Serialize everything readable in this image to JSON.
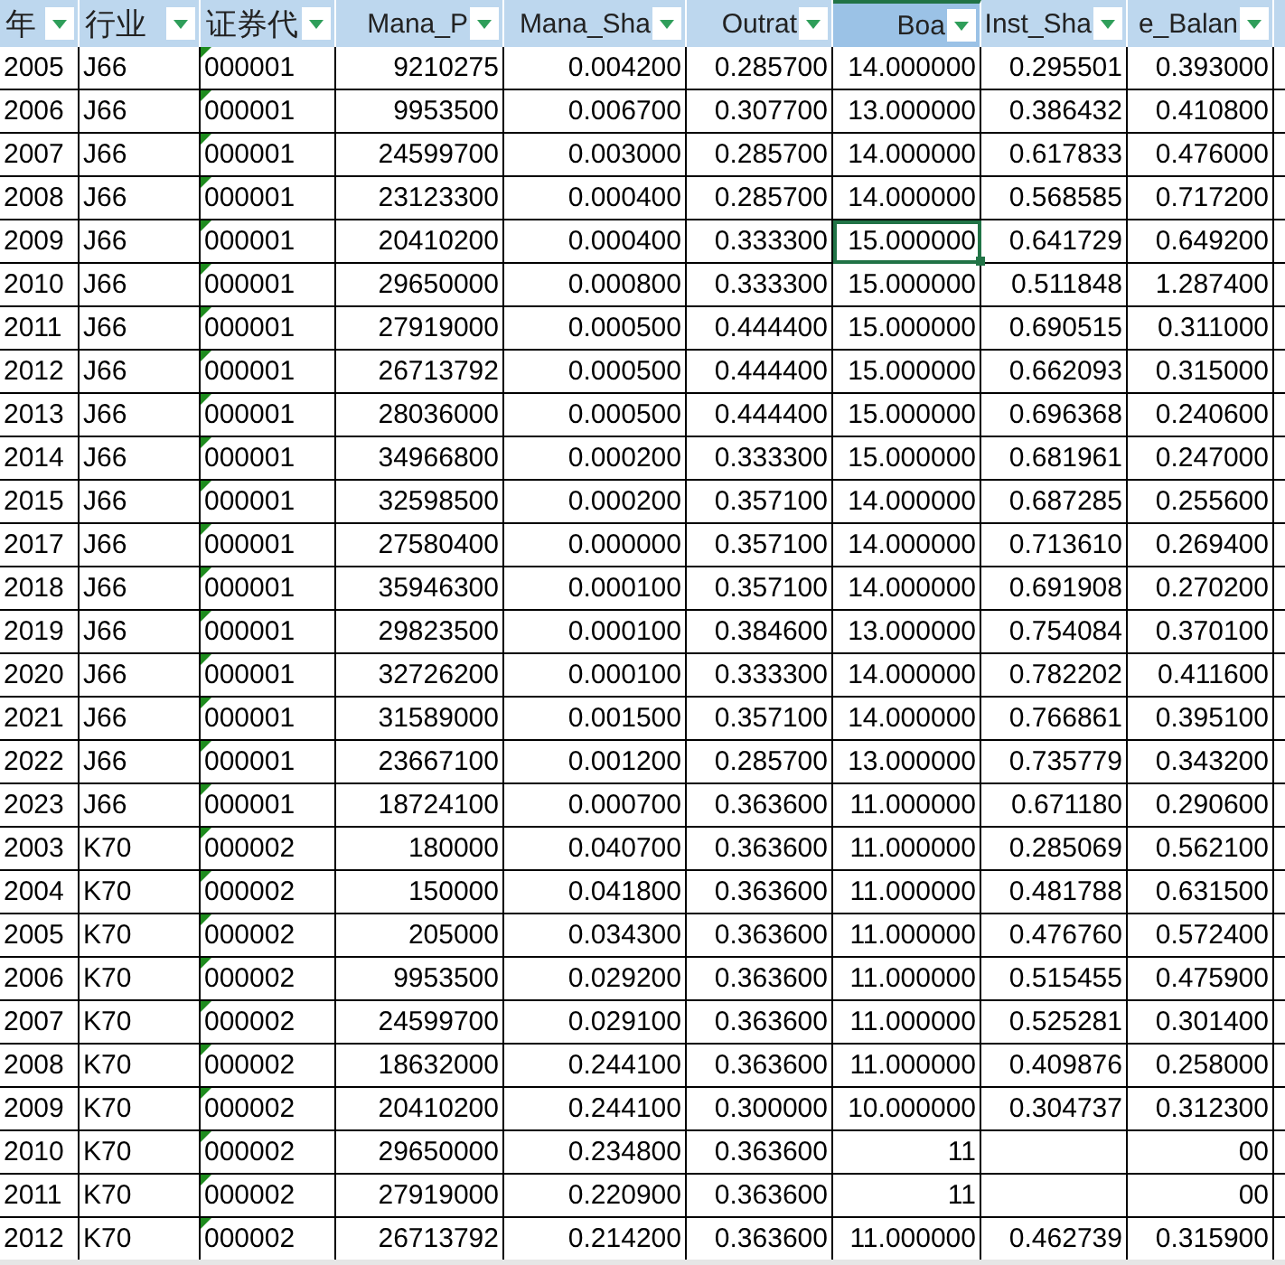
{
  "columns": [
    {
      "label": "年",
      "kind": "number",
      "selected": false,
      "text_warning": false
    },
    {
      "label": "行业",
      "kind": "text",
      "selected": false,
      "text_warning": false
    },
    {
      "label": "证券代",
      "kind": "text",
      "selected": false,
      "text_warning": true
    },
    {
      "label": "Mana_P",
      "kind": "number",
      "selected": false,
      "text_warning": false
    },
    {
      "label": "Mana_Sha",
      "kind": "number",
      "selected": false,
      "text_warning": false
    },
    {
      "label": "Outrat",
      "kind": "number",
      "selected": false,
      "text_warning": false
    },
    {
      "label": "Boa",
      "kind": "number",
      "selected": true,
      "text_warning": false
    },
    {
      "label": "Inst_Sha",
      "kind": "number",
      "selected": false,
      "text_warning": false
    },
    {
      "label": "e_Balan",
      "kind": "number",
      "selected": false,
      "text_warning": false
    }
  ],
  "rows": [
    {
      "cells": [
        "2005",
        "J66",
        "000001",
        "9210275",
        "0.004200",
        "0.285700",
        "14.000000",
        "0.295501",
        "0.393000"
      ]
    },
    {
      "cells": [
        "2006",
        "J66",
        "000001",
        "9953500",
        "0.006700",
        "0.307700",
        "13.000000",
        "0.386432",
        "0.410800"
      ]
    },
    {
      "cells": [
        "2007",
        "J66",
        "000001",
        "24599700",
        "0.003000",
        "0.285700",
        "14.000000",
        "0.617833",
        "0.476000"
      ]
    },
    {
      "cells": [
        "2008",
        "J66",
        "000001",
        "23123300",
        "0.000400",
        "0.285700",
        "14.000000",
        "0.568585",
        "0.717200"
      ]
    },
    {
      "cells": [
        "2009",
        "J66",
        "000001",
        "20410200",
        "0.000400",
        "0.333300",
        {
          "text": "15.000000",
          "selected": true
        },
        "0.641729",
        "0.649200"
      ]
    },
    {
      "cells": [
        "2010",
        "J66",
        "000001",
        "29650000",
        "0.000800",
        "0.333300",
        "15.000000",
        "0.511848",
        "1.287400"
      ]
    },
    {
      "cells": [
        "2011",
        "J66",
        "000001",
        "27919000",
        "0.000500",
        "0.444400",
        "15.000000",
        "0.690515",
        "0.311000"
      ]
    },
    {
      "cells": [
        "2012",
        "J66",
        "000001",
        "26713792",
        "0.000500",
        "0.444400",
        "15.000000",
        "0.662093",
        "0.315000"
      ]
    },
    {
      "cells": [
        "2013",
        "J66",
        "000001",
        "28036000",
        "0.000500",
        "0.444400",
        "15.000000",
        "0.696368",
        "0.240600"
      ]
    },
    {
      "cells": [
        "2014",
        "J66",
        "000001",
        "34966800",
        "0.000200",
        "0.333300",
        "15.000000",
        "0.681961",
        "0.247000"
      ]
    },
    {
      "cells": [
        "2015",
        "J66",
        "000001",
        "32598500",
        "0.000200",
        "0.357100",
        "14.000000",
        "0.687285",
        "0.255600"
      ]
    },
    {
      "cells": [
        "2017",
        "J66",
        "000001",
        "27580400",
        "0.000000",
        "0.357100",
        "14.000000",
        "0.713610",
        "0.269400"
      ]
    },
    {
      "cells": [
        "2018",
        "J66",
        "000001",
        "35946300",
        "0.000100",
        "0.357100",
        "14.000000",
        "0.691908",
        "0.270200"
      ]
    },
    {
      "cells": [
        "2019",
        "J66",
        "000001",
        "29823500",
        "0.000100",
        "0.384600",
        "13.000000",
        "0.754084",
        "0.370100"
      ]
    },
    {
      "cells": [
        "2020",
        "J66",
        "000001",
        "32726200",
        "0.000100",
        "0.333300",
        "14.000000",
        "0.782202",
        "0.411600"
      ]
    },
    {
      "cells": [
        "2021",
        "J66",
        "000001",
        "31589000",
        "0.001500",
        "0.357100",
        "14.000000",
        "0.766861",
        "0.395100"
      ]
    },
    {
      "cells": [
        "2022",
        "J66",
        "000001",
        "23667100",
        "0.001200",
        "0.285700",
        "13.000000",
        "0.735779",
        "0.343200"
      ]
    },
    {
      "cells": [
        "2023",
        "J66",
        "000001",
        "18724100",
        "0.000700",
        "0.363600",
        "11.000000",
        "0.671180",
        "0.290600"
      ]
    },
    {
      "cells": [
        "2003",
        "K70",
        "000002",
        "180000",
        "0.040700",
        "0.363600",
        "11.000000",
        "0.285069",
        "0.562100"
      ]
    },
    {
      "cells": [
        "2004",
        "K70",
        "000002",
        "150000",
        "0.041800",
        "0.363600",
        "11.000000",
        "0.481788",
        "0.631500"
      ]
    },
    {
      "cells": [
        "2005",
        "K70",
        "000002",
        "205000",
        "0.034300",
        "0.363600",
        "11.000000",
        "0.476760",
        "0.572400"
      ]
    },
    {
      "cells": [
        "2006",
        "K70",
        "000002",
        "9953500",
        "0.029200",
        "0.363600",
        "11.000000",
        "0.515455",
        "0.475900"
      ]
    },
    {
      "cells": [
        "2007",
        "K70",
        "000002",
        "24599700",
        "0.029100",
        "0.363600",
        "11.000000",
        "0.525281",
        "0.301400"
      ]
    },
    {
      "cells": [
        "2008",
        "K70",
        "000002",
        "18632000",
        "0.244100",
        "0.363600",
        "11.000000",
        "0.409876",
        "0.258000"
      ]
    },
    {
      "cells": [
        "2009",
        "K70",
        "000002",
        "20410200",
        "0.244100",
        "0.300000",
        "10.000000",
        "0.304737",
        "0.312300"
      ]
    },
    {
      "cells": [
        "2010",
        "K70",
        "000002",
        "29650000",
        "0.234800",
        "0.363600",
        "11",
        null,
        "00"
      ]
    },
    {
      "cells": [
        "2011",
        "K70",
        "000002",
        "27919000",
        "0.220900",
        "0.363600",
        "11",
        null,
        "00"
      ]
    },
    {
      "cells": [
        "2012",
        "K70",
        "000002",
        "26713792",
        "0.214200",
        "0.363600",
        "11.000000",
        "0.462739",
        "0.315900"
      ]
    }
  ]
}
